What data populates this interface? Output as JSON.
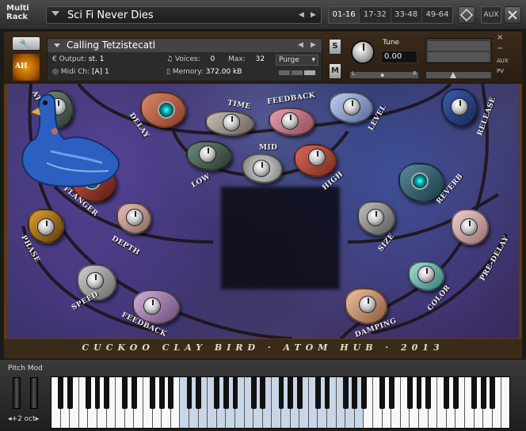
{
  "multi_rack": {
    "label_line1": "Multi",
    "label_line2": "Rack",
    "rack_name": "Sci Fi Never Dies",
    "tabs": [
      "01-16",
      "17-32",
      "33-48",
      "49-64"
    ],
    "aux_label": "AUX"
  },
  "instrument": {
    "logo_text": "AH",
    "name": "Calling Tetzistecatl",
    "output_label": "Output:",
    "output_value": "st. 1",
    "voices_label": "Voices:",
    "voices_value": "0",
    "max_label": "Max:",
    "max_value": "32",
    "purge_label": "Purge",
    "midi_label": "Midi Ch:",
    "midi_value": "[A] 1",
    "memory_label": "Memory:",
    "memory_value": "372.00 kB",
    "solo": "S",
    "mute": "M",
    "tune_label": "Tune",
    "tune_value": "0.00",
    "pan_left": "L",
    "pan_right": "R",
    "aux_side": "AUX",
    "pv_side": "PV"
  },
  "controls": {
    "attack": "ATTACK",
    "delay": "DELAY",
    "time": "TIME",
    "feedback_top": "FEEDBACK",
    "level": "LEVEL",
    "release": "RELEASE",
    "mid": "MID",
    "low": "LOW",
    "high": "HIGH",
    "flanger": "FLANGER",
    "reverb": "REVERB",
    "phase": "PHASE",
    "depth": "DEPTH",
    "size": "SIZE",
    "pre_delay": "PRE-DELAY",
    "speed": "SPEED",
    "color": "COLOR",
    "feedback_bottom": "FEEDBACK",
    "damping": "DAMPING"
  },
  "footer_text": "CUCKOO CLAY BIRD · ATOM HUB · 2013",
  "keyboard": {
    "pitch_mod_label": "Pitch Mod",
    "octave_label": "+2 oct"
  }
}
